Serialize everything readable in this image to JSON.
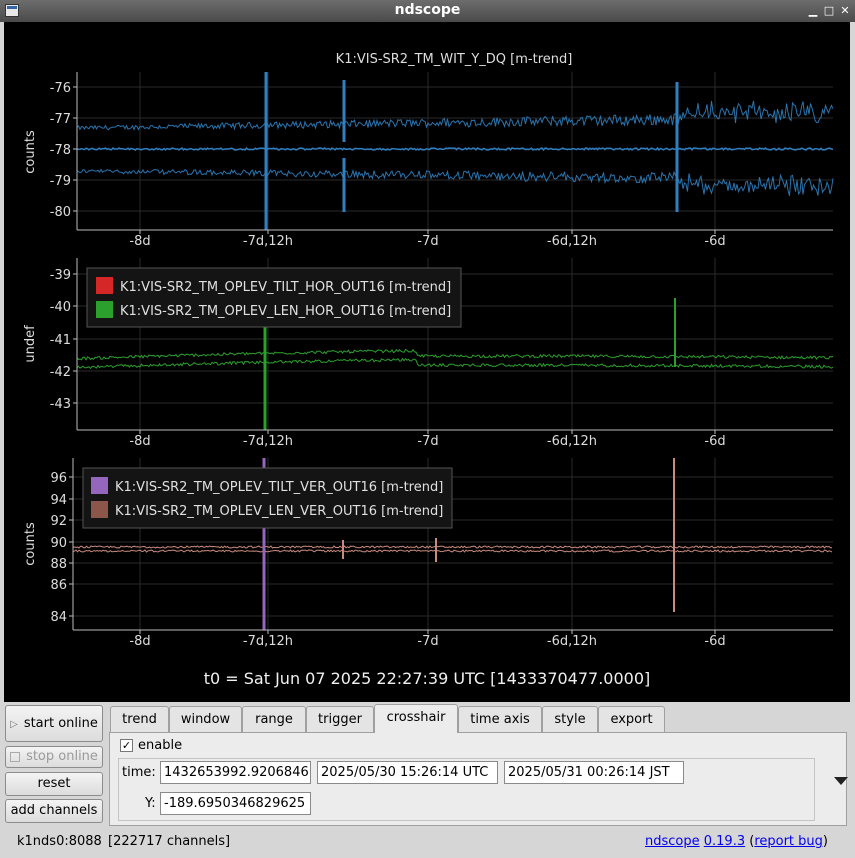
{
  "window": {
    "title": "ndscope"
  },
  "plots": [
    {
      "title": "K1:VIS-SR2_TM_WIT_Y_DQ [m-trend]",
      "ylabel": "counts",
      "yticks": [
        "-76",
        "-77",
        "-78",
        "-79",
        "-80"
      ],
      "xticks": [
        "-8d",
        "-7d,12h",
        "-7d",
        "-6d,12h",
        "-6d"
      ],
      "legend": []
    },
    {
      "title": "",
      "ylabel": "undef",
      "yticks": [
        "-39",
        "-40",
        "-41",
        "-42",
        "-43"
      ],
      "xticks": [
        "-8d",
        "-7d,12h",
        "-7d",
        "-6d,12h",
        "-6d"
      ],
      "legend": [
        {
          "label": "K1:VIS-SR2_TM_OPLEV_TILT_HOR_OUT16 [m-trend]",
          "color": "#d62728"
        },
        {
          "label": "K1:VIS-SR2_TM_OPLEV_LEN_HOR_OUT16 [m-trend]",
          "color": "#2ca02c"
        }
      ]
    },
    {
      "title": "",
      "ylabel": "counts",
      "yticks": [
        "96",
        "94",
        "92",
        "90",
        "88",
        "86",
        "84"
      ],
      "xticks": [
        "-8d",
        "-7d,12h",
        "-7d",
        "-6d,12h",
        "-6d"
      ],
      "legend": [
        {
          "label": "K1:VIS-SR2_TM_OPLEV_TILT_VER_OUT16 [m-trend]",
          "color": "#9467bd"
        },
        {
          "label": "K1:VIS-SR2_TM_OPLEV_LEN_VER_OUT16 [m-trend]",
          "color": "#8c564b"
        }
      ]
    }
  ],
  "t0_label": "t0 = Sat Jun 07 2025 22:27:39 UTC [1433370477.0000]",
  "sidebar": {
    "start_online": "start online",
    "stop_online": "stop online",
    "reset": "reset",
    "add_channels": "add channels"
  },
  "tabs": [
    "trend",
    "window",
    "range",
    "trigger",
    "crosshair",
    "time axis",
    "style",
    "export"
  ],
  "active_tab": "crosshair",
  "crosshair": {
    "enable_label": "enable",
    "enabled": true,
    "time_label": "time:",
    "time_gps": "1432653992.9206846",
    "time_utc": "2025/05/30 15:26:14 UTC",
    "time_jst": "2025/05/31 00:26:14 JST",
    "y_label": "Y:",
    "y_value": "-189.6950346829625"
  },
  "status": {
    "server": "k1nds0:8088",
    "channels": "[222717 channels]",
    "app_name": "ndscope",
    "version": "0.19.3",
    "paren_open": "(",
    "report_bug": "report bug",
    "paren_close": ")"
  },
  "colors": {
    "trace_blue": "#2f7fc1",
    "trace_green": "#2ca02c",
    "trace_brown": "#c98b7e",
    "trace_purple": "#9467bd"
  }
}
